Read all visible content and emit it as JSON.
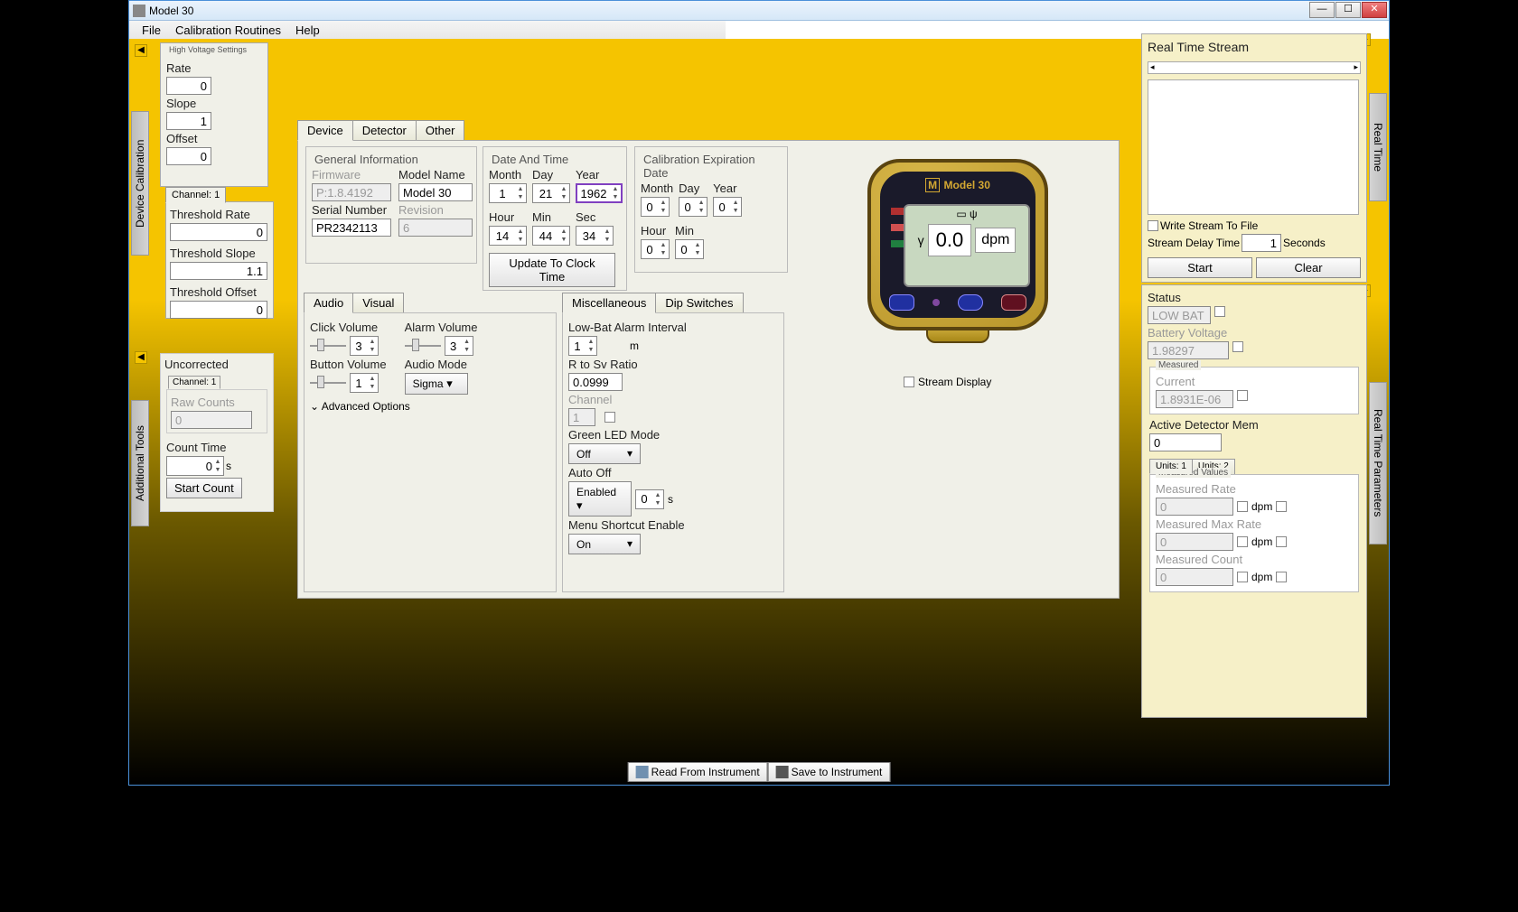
{
  "window": {
    "title": "Model 30"
  },
  "menu": {
    "file": "File",
    "cal": "Calibration Routines",
    "help": "Help"
  },
  "side_left": {
    "tab_devcal": "Device Calibration",
    "tab_addtools": "Additional Tools",
    "hv": {
      "legend": "High Voltage Settings",
      "rate": "Rate",
      "rate_v": "0",
      "slope": "Slope",
      "slope_v": "1",
      "offset": "Offset",
      "offset_v": "0"
    },
    "ch_tab": "Channel: 1",
    "ch": {
      "trate": "Threshold Rate",
      "trate_v": "0",
      "tslope": "Threshold Slope",
      "tslope_v": "1.1",
      "toffset": "Threshold Offset",
      "toffset_v": "0"
    },
    "uncorr": {
      "title": "Uncorrected",
      "ch": "Channel: 1",
      "raw": "Raw Counts",
      "raw_v": "0",
      "ctime": "Count Time",
      "ctime_v": "0",
      "unit": "s",
      "start": "Start Count"
    }
  },
  "main": {
    "tabs": {
      "device": "Device",
      "detector": "Detector",
      "other": "Other"
    },
    "gen": {
      "legend": "General Information",
      "fw": "Firmware",
      "fw_v": "P:1.8.4192",
      "model": "Model Name",
      "model_v": "Model 30",
      "serial": "Serial Number",
      "serial_v": "PR2342113",
      "rev": "Revision",
      "rev_v": "6"
    },
    "dt": {
      "legend": "Date And Time",
      "month": "Month",
      "day": "Day",
      "year": "Year",
      "hour": "Hour",
      "min": "Min",
      "sec": "Sec",
      "m_v": "1",
      "d_v": "21",
      "y_v": "1962",
      "h_v": "14",
      "mi_v": "44",
      "s_v": "34",
      "update": "Update To Clock Time"
    },
    "calexp": {
      "legend": "Calibration Expiration Date",
      "month": "Month",
      "day": "Day",
      "year": "Year",
      "hour": "Hour",
      "min": "Min",
      "m_v": "0",
      "d_v": "0",
      "y_v": "0",
      "h_v": "0",
      "mi_v": "0"
    },
    "av": {
      "audio": "Audio",
      "visual": "Visual",
      "clickv": "Click Volume",
      "clickv_v": "3",
      "alarmv": "Alarm Volume",
      "alarmv_v": "3",
      "btnv": "Button Volume",
      "btnv_v": "1",
      "amode": "Audio Mode",
      "amode_v": "Sigma",
      "adv": "Advanced Options"
    },
    "misc": {
      "tab1": "Miscellaneous",
      "tab2": "Dip Switches",
      "lbai": "Low-Bat Alarm Interval",
      "lbai_v": "1",
      "lbai_u": "m",
      "rsv": "R to Sv Ratio",
      "rsv_v": "0.0999",
      "chan": "Channel",
      "chan_v": "1",
      "gled": "Green LED Mode",
      "gled_v": "Off",
      "autooff": "Auto Off",
      "autooff_v": "Enabled",
      "autooff_s": "0",
      "autooff_u": "s",
      "mse": "Menu Shortcut Enable",
      "mse_v": "On"
    },
    "device": {
      "title": "Model 30",
      "reading": "0.0",
      "unit": "dpm",
      "gamma": "γ",
      "stream_chk": "Stream Display"
    }
  },
  "right": {
    "rts": {
      "title": "Real Time Stream",
      "write": "Write Stream To File",
      "delay": "Stream Delay Time",
      "delay_v": "1",
      "delay_u": "Seconds",
      "start": "Start",
      "clear": "Clear"
    },
    "status": {
      "status": "Status",
      "status_v": "LOW BAT",
      "bv": "Battery Voltage",
      "bv_v": "1.98297"
    },
    "meas": {
      "legend": "Measured",
      "cur": "Current",
      "cur_v": "1.8931E-06",
      "adm": "Active Detector Mem",
      "adm_v": "0"
    },
    "units": {
      "u1": "Units: 1",
      "u2": "Units: 2"
    },
    "mv": {
      "legend": "Measured Values",
      "rate": "Measured Rate",
      "rate_v": "0",
      "rate_u": "dpm",
      "max": "Measured Max Rate",
      "max_v": "0",
      "max_u": "dpm",
      "cnt": "Measured Count",
      "cnt_v": "0",
      "cnt_u": "dpm"
    },
    "vtab1": "Real Time",
    "vtab2": "Real Time Parameters"
  },
  "footer": {
    "read": "Read From Instrument",
    "save": "Save to Instrument"
  }
}
